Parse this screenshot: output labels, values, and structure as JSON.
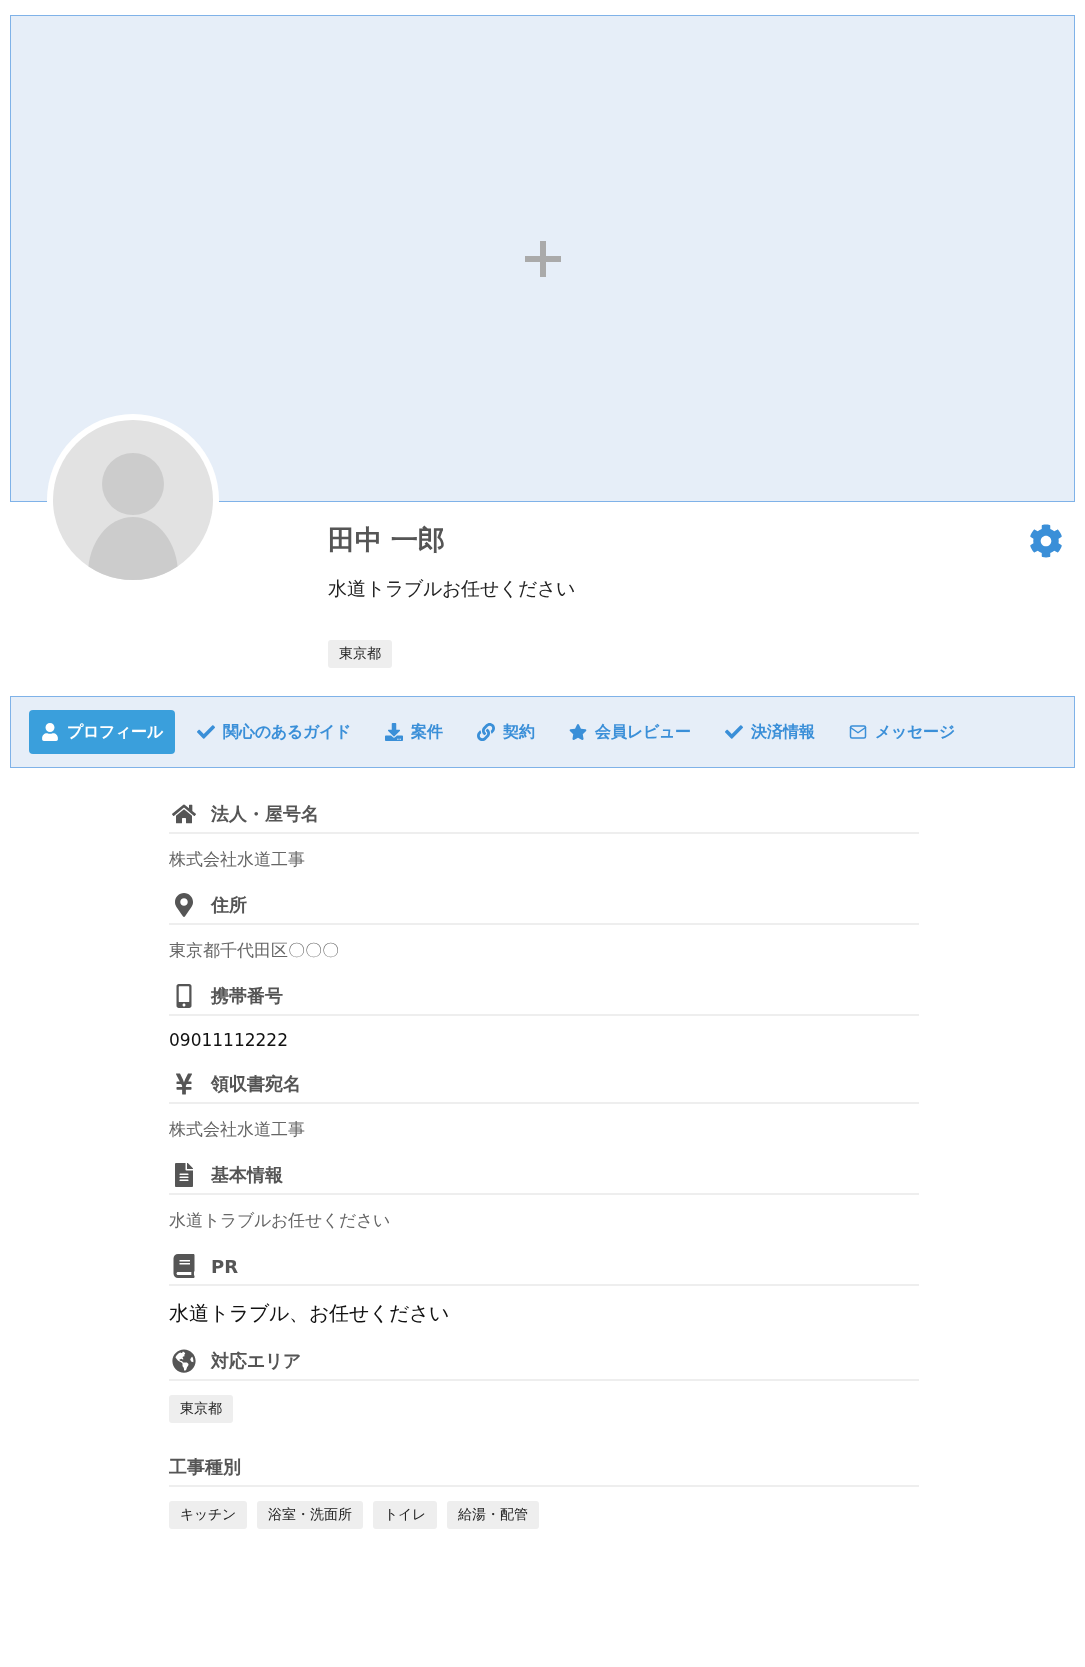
{
  "profile": {
    "name": "田中 一郎",
    "tagline": "水道トラブルお任せください",
    "tags": [
      "東京都"
    ]
  },
  "tabs": [
    {
      "label": "プロフィール",
      "selected": true
    },
    {
      "label": "関心のあるガイド",
      "selected": false
    },
    {
      "label": "案件",
      "selected": false
    },
    {
      "label": "契約",
      "selected": false
    },
    {
      "label": "会員レビュー",
      "selected": false
    },
    {
      "label": "決済情報",
      "selected": false
    },
    {
      "label": "メッセージ",
      "selected": false
    }
  ],
  "sections": [
    {
      "title": "法人・屋号名",
      "kind": "muted",
      "value": "株式会社水道工事"
    },
    {
      "title": "住所",
      "kind": "muted",
      "value": "東京都千代田区〇〇〇"
    },
    {
      "title": "携帯番号",
      "kind": "plain",
      "value": "09011112222"
    },
    {
      "title": "領収書宛名",
      "kind": "muted",
      "value": "株式会社水道工事"
    },
    {
      "title": "基本情報",
      "kind": "muted",
      "value": "水道トラブルお任せください"
    },
    {
      "title": "PR",
      "kind": "large",
      "value": "水道トラブル、お任せください"
    },
    {
      "title": "対応エリア",
      "kind": "tags",
      "tags": [
        "東京都"
      ]
    },
    {
      "title": "工事種別",
      "kind": "tags",
      "tags": [
        "キッチン",
        "浴室・洗面所",
        "トイレ",
        "給湯・配管"
      ]
    }
  ]
}
